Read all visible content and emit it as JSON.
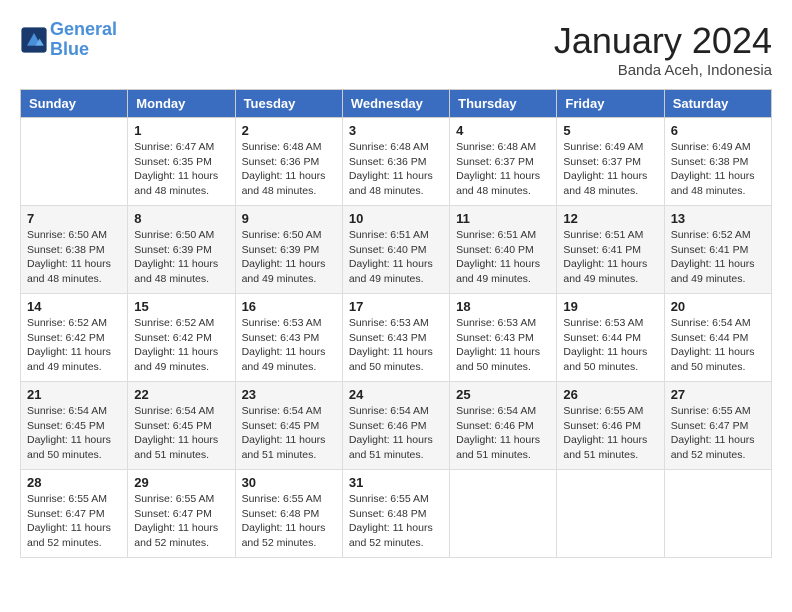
{
  "header": {
    "logo_line1": "General",
    "logo_line2": "Blue",
    "month": "January 2024",
    "location": "Banda Aceh, Indonesia"
  },
  "weekdays": [
    "Sunday",
    "Monday",
    "Tuesday",
    "Wednesday",
    "Thursday",
    "Friday",
    "Saturday"
  ],
  "weeks": [
    [
      {
        "day": "",
        "info": ""
      },
      {
        "day": "1",
        "info": "Sunrise: 6:47 AM\nSunset: 6:35 PM\nDaylight: 11 hours\nand 48 minutes."
      },
      {
        "day": "2",
        "info": "Sunrise: 6:48 AM\nSunset: 6:36 PM\nDaylight: 11 hours\nand 48 minutes."
      },
      {
        "day": "3",
        "info": "Sunrise: 6:48 AM\nSunset: 6:36 PM\nDaylight: 11 hours\nand 48 minutes."
      },
      {
        "day": "4",
        "info": "Sunrise: 6:48 AM\nSunset: 6:37 PM\nDaylight: 11 hours\nand 48 minutes."
      },
      {
        "day": "5",
        "info": "Sunrise: 6:49 AM\nSunset: 6:37 PM\nDaylight: 11 hours\nand 48 minutes."
      },
      {
        "day": "6",
        "info": "Sunrise: 6:49 AM\nSunset: 6:38 PM\nDaylight: 11 hours\nand 48 minutes."
      }
    ],
    [
      {
        "day": "7",
        "info": "Sunrise: 6:50 AM\nSunset: 6:38 PM\nDaylight: 11 hours\nand 48 minutes."
      },
      {
        "day": "8",
        "info": "Sunrise: 6:50 AM\nSunset: 6:39 PM\nDaylight: 11 hours\nand 48 minutes."
      },
      {
        "day": "9",
        "info": "Sunrise: 6:50 AM\nSunset: 6:39 PM\nDaylight: 11 hours\nand 49 minutes."
      },
      {
        "day": "10",
        "info": "Sunrise: 6:51 AM\nSunset: 6:40 PM\nDaylight: 11 hours\nand 49 minutes."
      },
      {
        "day": "11",
        "info": "Sunrise: 6:51 AM\nSunset: 6:40 PM\nDaylight: 11 hours\nand 49 minutes."
      },
      {
        "day": "12",
        "info": "Sunrise: 6:51 AM\nSunset: 6:41 PM\nDaylight: 11 hours\nand 49 minutes."
      },
      {
        "day": "13",
        "info": "Sunrise: 6:52 AM\nSunset: 6:41 PM\nDaylight: 11 hours\nand 49 minutes."
      }
    ],
    [
      {
        "day": "14",
        "info": "Sunrise: 6:52 AM\nSunset: 6:42 PM\nDaylight: 11 hours\nand 49 minutes."
      },
      {
        "day": "15",
        "info": "Sunrise: 6:52 AM\nSunset: 6:42 PM\nDaylight: 11 hours\nand 49 minutes."
      },
      {
        "day": "16",
        "info": "Sunrise: 6:53 AM\nSunset: 6:43 PM\nDaylight: 11 hours\nand 49 minutes."
      },
      {
        "day": "17",
        "info": "Sunrise: 6:53 AM\nSunset: 6:43 PM\nDaylight: 11 hours\nand 50 minutes."
      },
      {
        "day": "18",
        "info": "Sunrise: 6:53 AM\nSunset: 6:43 PM\nDaylight: 11 hours\nand 50 minutes."
      },
      {
        "day": "19",
        "info": "Sunrise: 6:53 AM\nSunset: 6:44 PM\nDaylight: 11 hours\nand 50 minutes."
      },
      {
        "day": "20",
        "info": "Sunrise: 6:54 AM\nSunset: 6:44 PM\nDaylight: 11 hours\nand 50 minutes."
      }
    ],
    [
      {
        "day": "21",
        "info": "Sunrise: 6:54 AM\nSunset: 6:45 PM\nDaylight: 11 hours\nand 50 minutes."
      },
      {
        "day": "22",
        "info": "Sunrise: 6:54 AM\nSunset: 6:45 PM\nDaylight: 11 hours\nand 51 minutes."
      },
      {
        "day": "23",
        "info": "Sunrise: 6:54 AM\nSunset: 6:45 PM\nDaylight: 11 hours\nand 51 minutes."
      },
      {
        "day": "24",
        "info": "Sunrise: 6:54 AM\nSunset: 6:46 PM\nDaylight: 11 hours\nand 51 minutes."
      },
      {
        "day": "25",
        "info": "Sunrise: 6:54 AM\nSunset: 6:46 PM\nDaylight: 11 hours\nand 51 minutes."
      },
      {
        "day": "26",
        "info": "Sunrise: 6:55 AM\nSunset: 6:46 PM\nDaylight: 11 hours\nand 51 minutes."
      },
      {
        "day": "27",
        "info": "Sunrise: 6:55 AM\nSunset: 6:47 PM\nDaylight: 11 hours\nand 52 minutes."
      }
    ],
    [
      {
        "day": "28",
        "info": "Sunrise: 6:55 AM\nSunset: 6:47 PM\nDaylight: 11 hours\nand 52 minutes."
      },
      {
        "day": "29",
        "info": "Sunrise: 6:55 AM\nSunset: 6:47 PM\nDaylight: 11 hours\nand 52 minutes."
      },
      {
        "day": "30",
        "info": "Sunrise: 6:55 AM\nSunset: 6:48 PM\nDaylight: 11 hours\nand 52 minutes."
      },
      {
        "day": "31",
        "info": "Sunrise: 6:55 AM\nSunset: 6:48 PM\nDaylight: 11 hours\nand 52 minutes."
      },
      {
        "day": "",
        "info": ""
      },
      {
        "day": "",
        "info": ""
      },
      {
        "day": "",
        "info": ""
      }
    ]
  ]
}
